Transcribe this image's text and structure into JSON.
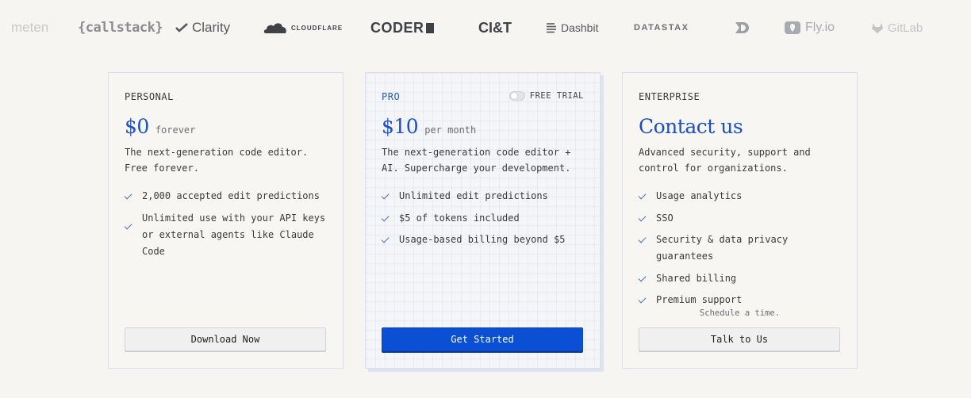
{
  "logos": [
    {
      "name": "meten",
      "text": "meten"
    },
    {
      "name": "callstack",
      "text": "{callstack}"
    },
    {
      "name": "clarity",
      "text": "Clarity"
    },
    {
      "name": "cloudflare",
      "text": "CLOUDFLARE"
    },
    {
      "name": "coder",
      "text": "CODER"
    },
    {
      "name": "ciandt",
      "text": "CI&T"
    },
    {
      "name": "dashbit",
      "text": "Dashbit"
    },
    {
      "name": "datastax",
      "text": "DATASTAX"
    },
    {
      "name": "db",
      "text": "DB"
    },
    {
      "name": "flyio",
      "text": "Fly.io"
    },
    {
      "name": "gitlab",
      "text": "GitLab"
    }
  ],
  "plans": [
    {
      "tier": "PERSONAL",
      "price": "$0",
      "period": "forever",
      "description": "The next-generation code editor. Free forever.",
      "features": [
        "2,000 accepted edit predictions",
        "Unlimited use with your API keys or external agents like Claude Code"
      ],
      "button": "Download Now"
    },
    {
      "tier": "PRO",
      "trial_label": "FREE TRIAL",
      "trial_enabled": false,
      "price": "$10",
      "period": "per month",
      "description": "The next-generation code editor + AI. Supercharge your development.",
      "features": [
        "Unlimited edit predictions",
        "$5 of tokens included",
        "Usage-based billing beyond $5"
      ],
      "button": "Get Started"
    },
    {
      "tier": "ENTERPRISE",
      "price": "Contact us",
      "description": "Advanced security, support and control for organizations.",
      "features": [
        "Usage analytics",
        "SSO",
        "Security & data privacy guarantees",
        "Shared billing",
        "Premium support"
      ],
      "schedule_note": "Schedule a time.",
      "button": "Talk to Us"
    }
  ],
  "colors": {
    "background": "#f6f5f1",
    "accent": "#1b4fc4",
    "primary_button": "#0a4fd4",
    "check": "#4a6fbf"
  }
}
